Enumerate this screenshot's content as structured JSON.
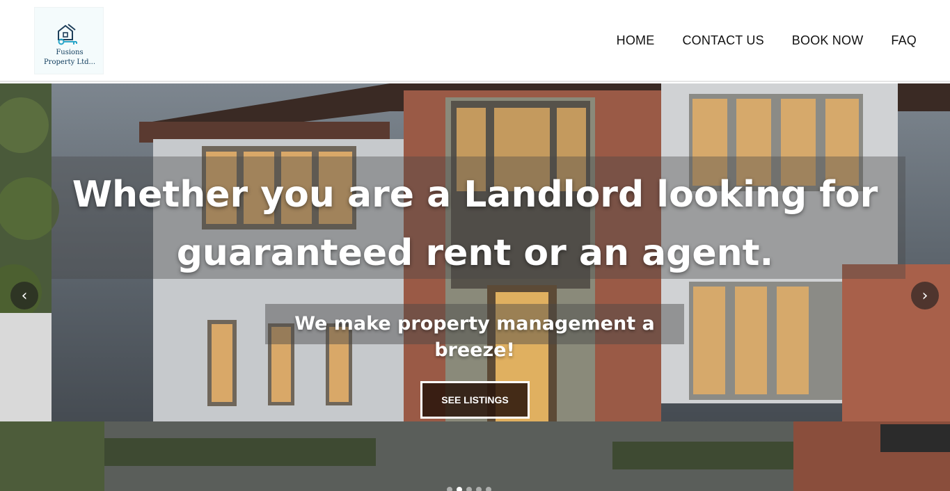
{
  "brand": {
    "name_line1": "Fusions",
    "name_line2": "Property Ltd...",
    "accent": "#2aa6c9"
  },
  "nav": {
    "items": [
      {
        "label": "HOME"
      },
      {
        "label": "CONTACT US"
      },
      {
        "label": "BOOK NOW"
      },
      {
        "label": "FAQ"
      }
    ]
  },
  "hero": {
    "headline": "Whether you are a Landlord looking for guaranteed rent or an agent.",
    "subheadline": "We make property management a breeze!",
    "cta_label": "SEE LISTINGS",
    "prev_icon": "‹",
    "next_icon": "›",
    "slide_count": 5,
    "active_slide": 2
  }
}
